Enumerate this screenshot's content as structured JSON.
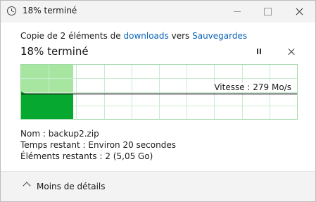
{
  "window": {
    "title": "18% terminé",
    "icon": "clock-icon"
  },
  "header": {
    "prefix": "Copie de 2 éléments de ",
    "source": "downloads",
    "middle": " vers ",
    "destination": "Sauvegardes"
  },
  "progress": {
    "title": "18% terminé",
    "fraction": 0.18,
    "speed_label": "Vitesse : 279 Mo/s"
  },
  "details": {
    "name_label": "Nom :",
    "name_value": "backup2.zip",
    "time_label": "Temps restant :",
    "time_value": "Environ 20 secondes",
    "items_label": "Éléments restants :",
    "items_value": "2 (5,05 Go)"
  },
  "footer": {
    "less_details": "Moins de détails"
  },
  "colors": {
    "accent_link": "#0b64b8",
    "graph_fill": "#06a82f",
    "graph_progress_bg": "#a6e6a0",
    "graph_grid": "#c9ecd0"
  }
}
